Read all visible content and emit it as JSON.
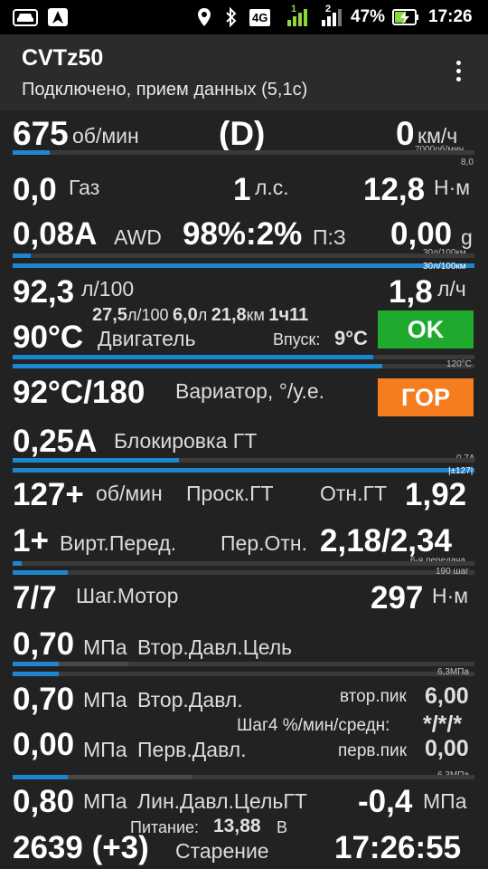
{
  "status_bar": {
    "network": "4G",
    "sim1": "1",
    "sim2": "2",
    "battery": "47%",
    "time": "17:26",
    "icons": [
      "car-icon",
      "navigation-icon",
      "location-icon",
      "bluetooth-icon",
      "signal-icon",
      "battery-charging-icon"
    ]
  },
  "app": {
    "title": "CVTz50",
    "subtitle": "Подключено, прием данных (5,1с)"
  },
  "rows": {
    "rpm": {
      "value": "675",
      "unit": "об/мин",
      "gear": "(D)",
      "speed": "0",
      "speed_unit": "км/ч",
      "bar_label": "7000об/мин",
      "bar2_label": "8,0",
      "bar_level": 0.08
    },
    "gas": {
      "value": "0,0",
      "label": "Газ",
      "hp": "1",
      "hp_unit": "л.с.",
      "torque": "12,8",
      "torque_unit": "Н·м"
    },
    "awd": {
      "value": "0,08A",
      "label": "AWD",
      "ratio": "98%:2%",
      "ratio_label": "П:З",
      "g": "0,00",
      "g_unit": "g",
      "bar_label": "30л/100км",
      "bar2_label": "30л/100км",
      "bar_level": 0.04,
      "bar2_level": 1.0
    },
    "fuel": {
      "value": "92,3",
      "unit": "л/100",
      "hourly": "1,8",
      "hourly_unit": "л/ч",
      "avg": "27,5",
      "avg_unit": "л/100",
      "liters": "6,0",
      "liters_unit": "л",
      "km": "21,8",
      "km_unit": "км",
      "time": "1ч11"
    },
    "engine": {
      "value": "90°C",
      "label": "Двигатель",
      "intake_label": "Впуск:",
      "intake": "9°C",
      "status": "OK",
      "status_color": "#1faa2e",
      "bar_label": "120°C",
      "bar_level": 0.78,
      "bar2_level": 0.8
    },
    "cvt": {
      "value": "92°C/180",
      "label": "Вариатор, °/у.е.",
      "status": "ГОР",
      "status_color": "#f57c1f"
    },
    "lockup": {
      "value": "0,25A",
      "label": "Блокировка ГТ",
      "bar_label": "0,7A",
      "bar2_label": "|±127|",
      "bar_level": 0.36,
      "bar2_level": 1.0
    },
    "slip": {
      "value": "127+",
      "unit": "об/мин",
      "label": "Проск.ГТ",
      "ratio_label": "Отн.ГТ",
      "ratio": "1,92"
    },
    "gear": {
      "value": "1+",
      "label": "Вирт.Перед.",
      "ratio_label": "Пер.Отн.",
      "ratio": "2,18/2,34",
      "bar_label": "6-я передача",
      "bar2_label": "190 шаг",
      "bar_level": 0.02,
      "bar2_level": 0.12
    },
    "motor": {
      "value": "7/7",
      "label": "Шаг.Мотор",
      "torque": "297",
      "torque_unit": "Н·м"
    },
    "sec_target": {
      "value": "0,70",
      "unit": "МПа",
      "label": "Втор.Давл.Цель",
      "bar_label": "6,3МПа",
      "bar_level": 0.1,
      "bar2_level": 0.1,
      "bar3_level": 0.25
    },
    "sec": {
      "value": "0,70",
      "unit": "МПа",
      "label": "Втор.Давл.",
      "peak_label": "втор.пик",
      "peak": "6,00"
    },
    "step": {
      "label": "Шаг4 %/мин/средн:",
      "value": "*/*/*"
    },
    "prim": {
      "value": "0,00",
      "unit": "МПа",
      "label": "Перв.Давл.",
      "peak_label": "перв.пик",
      "peak": "0,00",
      "bar_label": "6,3МПа",
      "bar_level": 0.12,
      "bar2_level": 0.39
    },
    "line": {
      "value": "0,80",
      "unit": "МПа",
      "label": "Лин.Давл.ЦельГТ",
      "tc": "-0,4",
      "tc_unit": "МПа"
    },
    "power": {
      "label": "Питание:",
      "value": "13,88",
      "unit": "В"
    },
    "aging": {
      "value": "2639 (+3)",
      "label": "Старение",
      "clock": "17:26:55"
    }
  }
}
